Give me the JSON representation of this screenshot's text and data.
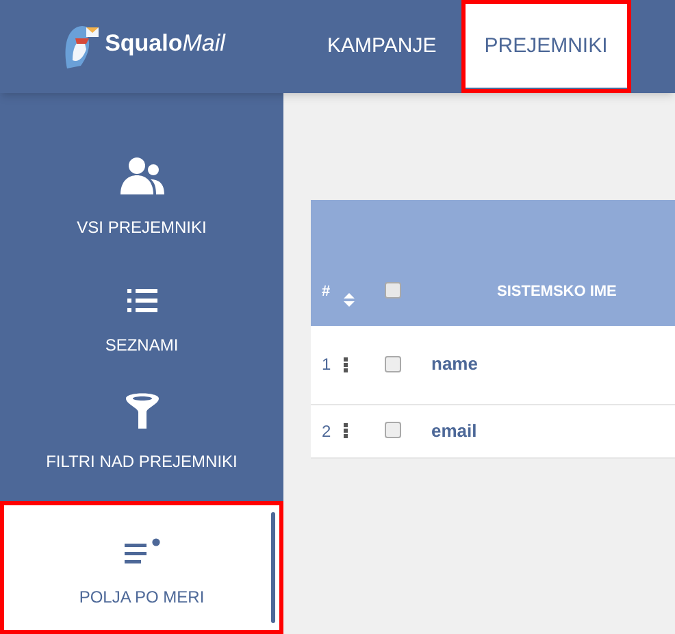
{
  "logo": {
    "word_bold": "Squalo",
    "word_light": "Mail"
  },
  "nav": [
    {
      "label": "KAMPANJE",
      "selected": false,
      "highlighted": false
    },
    {
      "label": "PREJEMNIKI",
      "selected": true,
      "highlighted": true
    }
  ],
  "sidebar": {
    "items": [
      {
        "kind": "people",
        "label": "VSI PREJEMNIKI",
        "selected": false,
        "highlighted": false
      },
      {
        "kind": "list",
        "label": "SEZNAMI",
        "selected": false,
        "highlighted": false
      },
      {
        "kind": "filter",
        "label": "FILTRI NAD PREJEMNIKI",
        "selected": false,
        "highlighted": false
      },
      {
        "kind": "fields",
        "label": "POLJA PO MERI",
        "selected": true,
        "highlighted": true
      }
    ]
  },
  "table": {
    "columns": [
      "#",
      "SISTEMSKO IME"
    ],
    "header_checked": false,
    "rows": [
      {
        "number": "1",
        "name": "name",
        "checked": false
      },
      {
        "number": "2",
        "name": "email",
        "checked": false
      }
    ]
  }
}
